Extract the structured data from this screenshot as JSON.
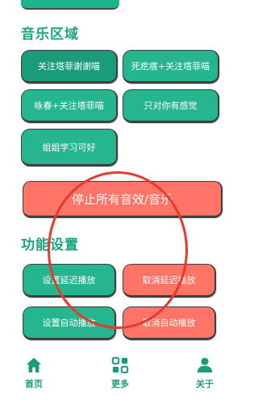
{
  "music_section": {
    "title": "音乐区域",
    "buttons": [
      "关注塔菲谢谢喵",
      "死疙瘩+关注塔菲喵",
      "咏春+关注塔菲喵",
      "只对你有感觉",
      "姐姐学习可好"
    ],
    "stop_label": "停止所有音效/音乐"
  },
  "function_section": {
    "title": "功能设置",
    "buttons": [
      "设置延迟播放",
      "取消延迟播放",
      "设置自动播放",
      "取消自动播放"
    ]
  },
  "bottom_nav": [
    {
      "label": "首页",
      "icon": "home-icon"
    },
    {
      "label": "更多",
      "icon": "more-icon"
    },
    {
      "label": "关于",
      "icon": "about-icon"
    }
  ],
  "colors": {
    "accent": "#1db48b",
    "danger": "#ff7466",
    "annotation": "#e43a2f"
  }
}
